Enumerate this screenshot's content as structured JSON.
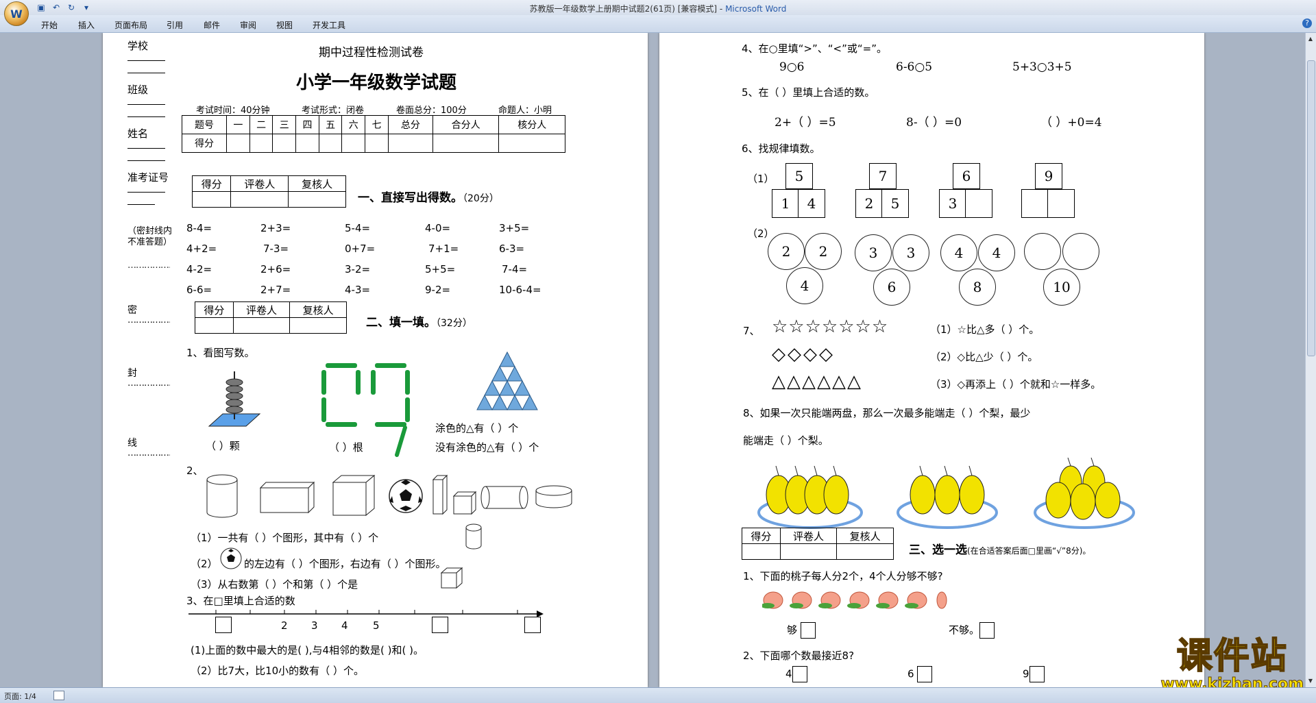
{
  "window": {
    "title": "苏教版一年级数学上册期中试题2(61页) [兼容模式]",
    "app_name": "Microsoft Word",
    "title_separator": " - "
  },
  "ribbon_tabs": [
    "开始",
    "插入",
    "页面布局",
    "引用",
    "邮件",
    "审阅",
    "视图",
    "开发工具"
  ],
  "status": {
    "page": "页面: 1/4"
  },
  "page1": {
    "header": "期中过程性检测试卷",
    "title": "小学一年级数学试题",
    "exam_info": [
      "考试时间：40分钟",
      "考试形式：闭卷",
      "卷面总分：100分",
      "命题人：小明"
    ],
    "left_margin": {
      "fields": [
        "学校",
        "班级",
        "姓名",
        "准考证号"
      ],
      "note": "（密封线内不准答题）",
      "seal_chars": [
        "密",
        "封",
        "线"
      ]
    },
    "score_table": {
      "row1": [
        "题号",
        "一",
        "二",
        "三",
        "四",
        "五",
        "六",
        "七",
        "总分",
        "合分人",
        "核分人"
      ],
      "row2_label": "得分"
    },
    "mini_table_headers": [
      "得分",
      "评卷人",
      "复核人"
    ],
    "section1": {
      "title": "一、直接写出得数。",
      "score": "（20分）",
      "rows": [
        [
          "8-4=",
          "2+3=",
          "5-4=",
          "4-0=",
          "3+5="
        ],
        [
          "4+2=",
          "7-3=",
          "0+7=",
          "7+1=",
          "6-3="
        ],
        [
          "4-2=",
          "2+6=",
          "3-2=",
          "5+5=",
          "7-4="
        ],
        [
          "6-6=",
          "2+7=",
          "4-3=",
          "9-2=",
          "10-6-4="
        ]
      ]
    },
    "section2": {
      "title": "二、填一填。",
      "score": "（32分）",
      "q1": "1、看图写数。",
      "q1_blank1": "（      ）颗",
      "q1_blank2": "（      ）根",
      "q1_tri1": "涂色的△有（      ）个",
      "q1_tri2": "没有涂色的△有（      ）个",
      "q2": "2、",
      "q2_a1": "（1）一共有（      ）个图形，其中有（      ）个",
      "q2_a2": "（2）",
      "q2_a2b": "的左边有（      ）个图形，右边有（      ）个图形。",
      "q2_a3": "（3）从右数第（      ）个和第（      ）个是",
      "q3": "3、在□里填上合适的数",
      "numline": [
        "2",
        "3",
        "4",
        "5"
      ],
      "q3_a1": "(1)上面的数中最大的是(      ),与4相邻的数是(      )和(      )。",
      "q3_a2": "（2）比7大，比10小的数有（      ）个。"
    }
  },
  "page2": {
    "q4": {
      "title": "4、在○里填“>”、“<”或“=”。",
      "items": [
        "9○6",
        "6-6○5",
        "5+3○3+5"
      ]
    },
    "q5": {
      "title": "5、在（      ）里填上合适的数。",
      "items": [
        "2+（    ）=5",
        "8-（    ）=0",
        "（    ）+0=4"
      ]
    },
    "q6": {
      "title": "6、找规律填数。",
      "label1": "（1）",
      "label2": "（2）",
      "houses": [
        {
          "top": "5",
          "left": "1",
          "right": "4"
        },
        {
          "top": "7",
          "left": "2",
          "right": "5"
        },
        {
          "top": "6",
          "left": "3",
          "right": ""
        },
        {
          "top": "9",
          "left": "",
          "right": ""
        }
      ],
      "circles": [
        {
          "a": "2",
          "b": "2",
          "c": "4"
        },
        {
          "a": "3",
          "b": "3",
          "c": "6"
        },
        {
          "a": "4",
          "b": "4",
          "c": "8"
        },
        {
          "a": "",
          "b": "",
          "c": "10"
        }
      ]
    },
    "q7": {
      "label": "7、",
      "stars": "☆☆☆☆☆☆☆",
      "diamonds": "◇◇◇◇",
      "triangles": "△△△△△△",
      "a1": "（1）☆比△多（      ）个。",
      "a2": "（2）◇比△少（      ）个。",
      "a3": "（3）◇再添上（      ）个就和☆一样多。"
    },
    "q8": {
      "line1": "8、如果一次只能端两盘，那么一次最多能端走（      ）个梨，最少",
      "line2": "能端走（      ）个梨。"
    },
    "section3": {
      "title": "三、选一选",
      "note": "(在合适答案后面□里画“√”8分)。",
      "q1": "1、下面的桃子每人分2个，4个人分够不够?",
      "opt_yes": "够",
      "opt_no": "不够。",
      "q2": "2、下面哪个数最接近8?",
      "q2_opts": [
        "4",
        "6",
        "9"
      ]
    }
  },
  "watermark": {
    "big": "课件站",
    "small": "www.kjzhan.com"
  },
  "colors": {
    "pear": "#f2e200",
    "plate": "#6fa2e0",
    "title_blue": "#2a5caa"
  }
}
